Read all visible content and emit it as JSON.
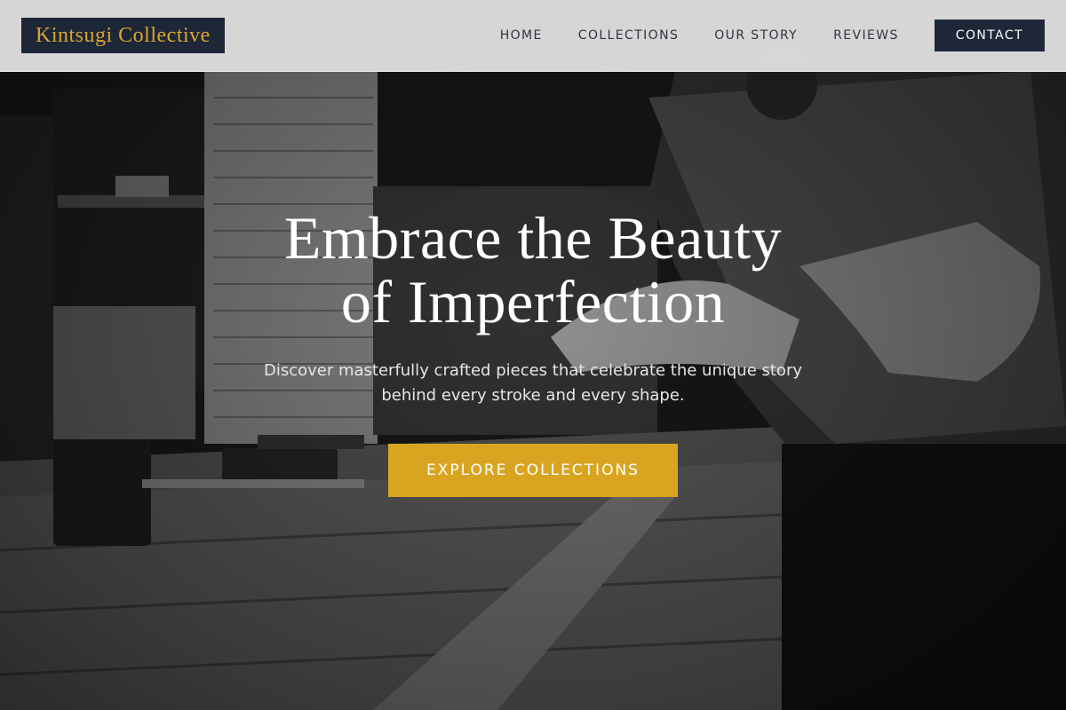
{
  "brand": {
    "name": "Kintsugi Collective"
  },
  "nav": {
    "items": [
      {
        "label": "HOME"
      },
      {
        "label": "COLLECTIONS"
      },
      {
        "label": "OUR STORY"
      },
      {
        "label": "REVIEWS"
      }
    ],
    "contact_label": "CONTACT"
  },
  "hero": {
    "headline_line1": "Embrace the Beauty",
    "headline_line2": "of Imperfection",
    "subtext": "Discover masterfully crafted pieces that celebrate the unique story behind every stroke and every shape.",
    "cta_label": "EXPLORE COLLECTIONS",
    "background_image": "grayscale-woodworking-workshop-photo"
  },
  "colors": {
    "brand_navy": "#1e2738",
    "brand_gold": "#d9a62c",
    "cta_gold": "#d9a521",
    "header_bg": "#e2e2e2"
  }
}
